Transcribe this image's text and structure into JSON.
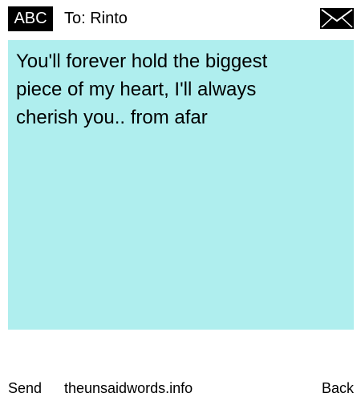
{
  "header": {
    "mode_label": "ABC",
    "recipient": "To: Rinto",
    "mail_icon": "envelope-icon"
  },
  "message": {
    "text": "You'll forever hold the biggest piece of my heart, I'll always cherish you.. from afar"
  },
  "footer": {
    "send_label": "Send",
    "site_label": "theunsaidwords.info",
    "back_label": "Back"
  },
  "colors": {
    "message_background": "#afeeee",
    "badge_background": "#000000",
    "badge_text": "#ffffff",
    "page_background": "#ffffff"
  }
}
